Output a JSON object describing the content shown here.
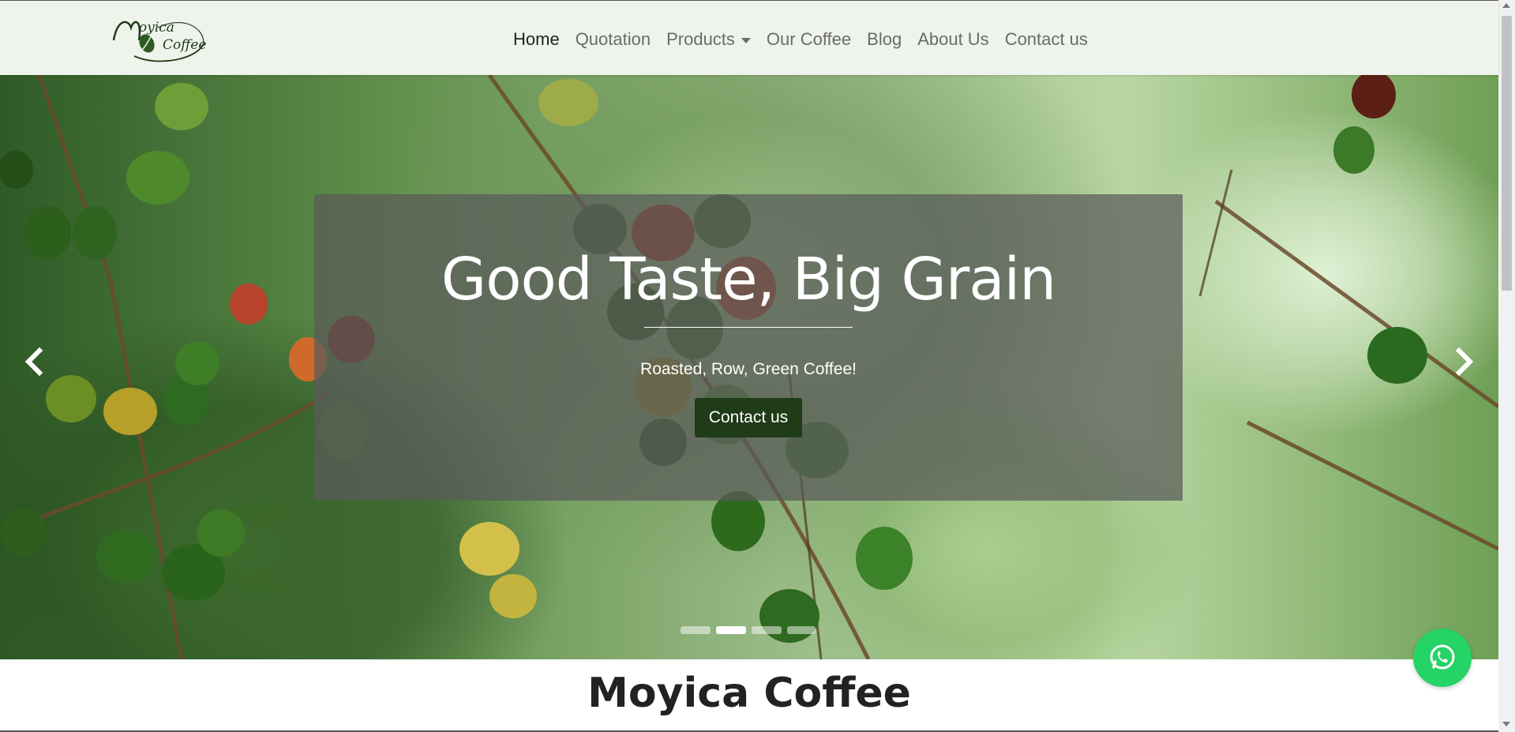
{
  "brand": {
    "logo_line1": "oyica",
    "logo_line2": "Coffee",
    "logo_initial": "M"
  },
  "nav": {
    "items": [
      {
        "label": "Home",
        "active": true
      },
      {
        "label": "Quotation"
      },
      {
        "label": "Products",
        "dropdown": true
      },
      {
        "label": "Our Coffee"
      },
      {
        "label": "Blog"
      },
      {
        "label": "About Us"
      },
      {
        "label": "Contact us"
      }
    ]
  },
  "hero": {
    "title": "Good Taste, Big Grain",
    "subtitle": "Roasted, Row, Green Coffee!",
    "button_label": "Contact us",
    "prev_icon": "chevron-left-icon",
    "next_icon": "chevron-right-icon",
    "slides_count": 4,
    "active_slide": 2
  },
  "section": {
    "title": "Moyica Coffee"
  },
  "floating": {
    "icon": "whatsapp-icon"
  },
  "colors": {
    "navbar_bg": "#eef3ec",
    "button_bg": "#1f3b17",
    "whatsapp": "#25d366"
  }
}
